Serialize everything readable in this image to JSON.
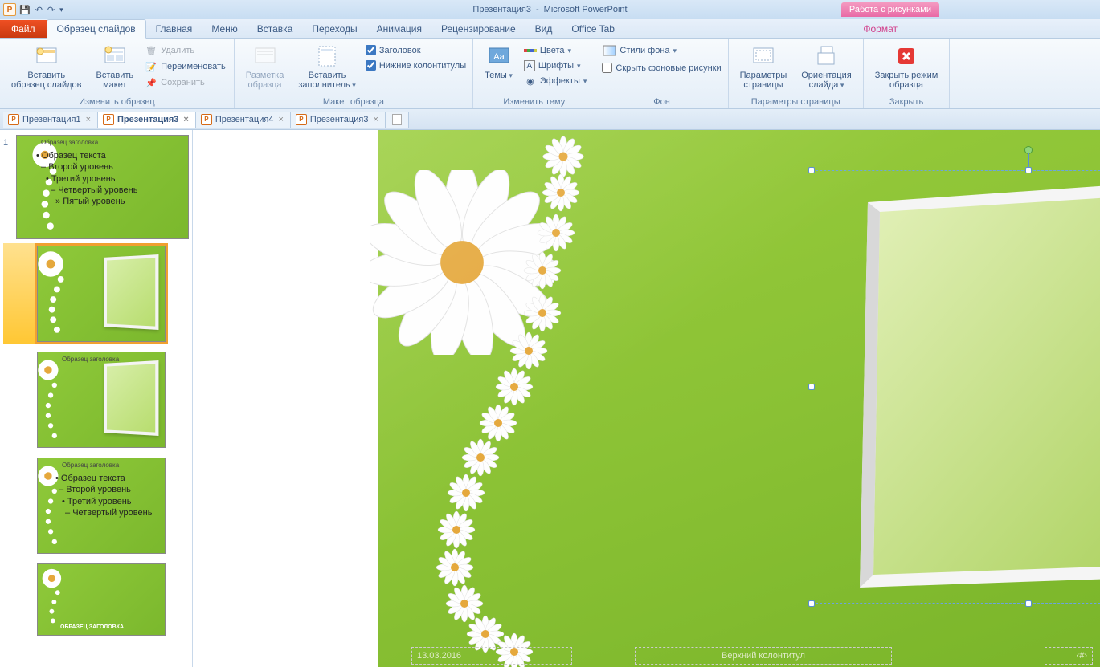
{
  "app": {
    "doc": "Презентация3",
    "sep": "-",
    "name": "Microsoft PowerPoint",
    "contextual": "Работа с рисунками"
  },
  "tabs": {
    "file": "Файл",
    "master": "Образец слайдов",
    "home": "Главная",
    "menu": "Меню",
    "insert": "Вставка",
    "transitions": "Переходы",
    "anim": "Анимация",
    "review": "Рецензирование",
    "view": "Вид",
    "officetab": "Office Tab",
    "format": "Формат"
  },
  "ribbon": {
    "edit_master_group": "Изменить образец",
    "insert_slide_master": "Вставить\nобразец слайдов",
    "insert_layout": "Вставить\nмакет",
    "delete": "Удалить",
    "rename": "Переименовать",
    "preserve": "Сохранить",
    "layout_group": "Макет образца",
    "master_layout": "Разметка\nобразца",
    "insert_placeholder": "Вставить\nзаполнитель",
    "title_chk": "Заголовок",
    "footers_chk": "Нижние колонтитулы",
    "theme_group": "Изменить тему",
    "themes": "Темы",
    "colors": "Цвета",
    "fonts": "Шрифты",
    "effects": "Эффекты",
    "background_group": "Фон",
    "bg_styles": "Стили фона",
    "hide_bg": "Скрыть фоновые рисунки",
    "page_setup_group": "Параметры страницы",
    "page_setup": "Параметры\nстраницы",
    "orientation": "Ориентация\nслайда",
    "close_group": "Закрыть",
    "close_master": "Закрыть режим\nобразца"
  },
  "doctabs": [
    {
      "name": "Презентация1",
      "active": false
    },
    {
      "name": "Презентация3",
      "active": true
    },
    {
      "name": "Презентация4",
      "active": false
    },
    {
      "name": "Презентация3",
      "active": false
    }
  ],
  "thumbs": {
    "num": "1",
    "master_title": "Образец заголовка",
    "master_lines": [
      "Образец текста",
      "Второй уровень",
      "Третий уровень",
      "Четвертый уровень",
      "Пятый уровень"
    ],
    "t3_title": "Образец заголовка",
    "t4_title": "Образец заголовка",
    "t5_title": "ОБРАЗЕЦ ЗАГОЛОВКА"
  },
  "slide": {
    "date": "13.03.2016",
    "footer": "Верхний колонтитул",
    "pagenum": "‹#›"
  }
}
